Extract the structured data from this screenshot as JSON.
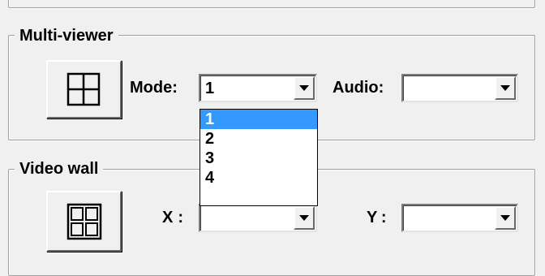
{
  "multi_viewer": {
    "group_label": "Multi-viewer",
    "icon": "grid-2x2-icon",
    "mode_label": "Mode:",
    "mode_value": "1",
    "audio_label": "Audio:",
    "audio_value": "",
    "mode_options": [
      "1",
      "2",
      "3",
      "4"
    ],
    "mode_selected_index": 0
  },
  "video_wall": {
    "group_label": "Video wall",
    "icon": "grid-2x2-double-icon",
    "x_label": "X:",
    "x_value": "",
    "y_label": "Y:",
    "y_value": ""
  },
  "colors": {
    "selection": "#3399ff",
    "background": "#f0f0f0"
  }
}
